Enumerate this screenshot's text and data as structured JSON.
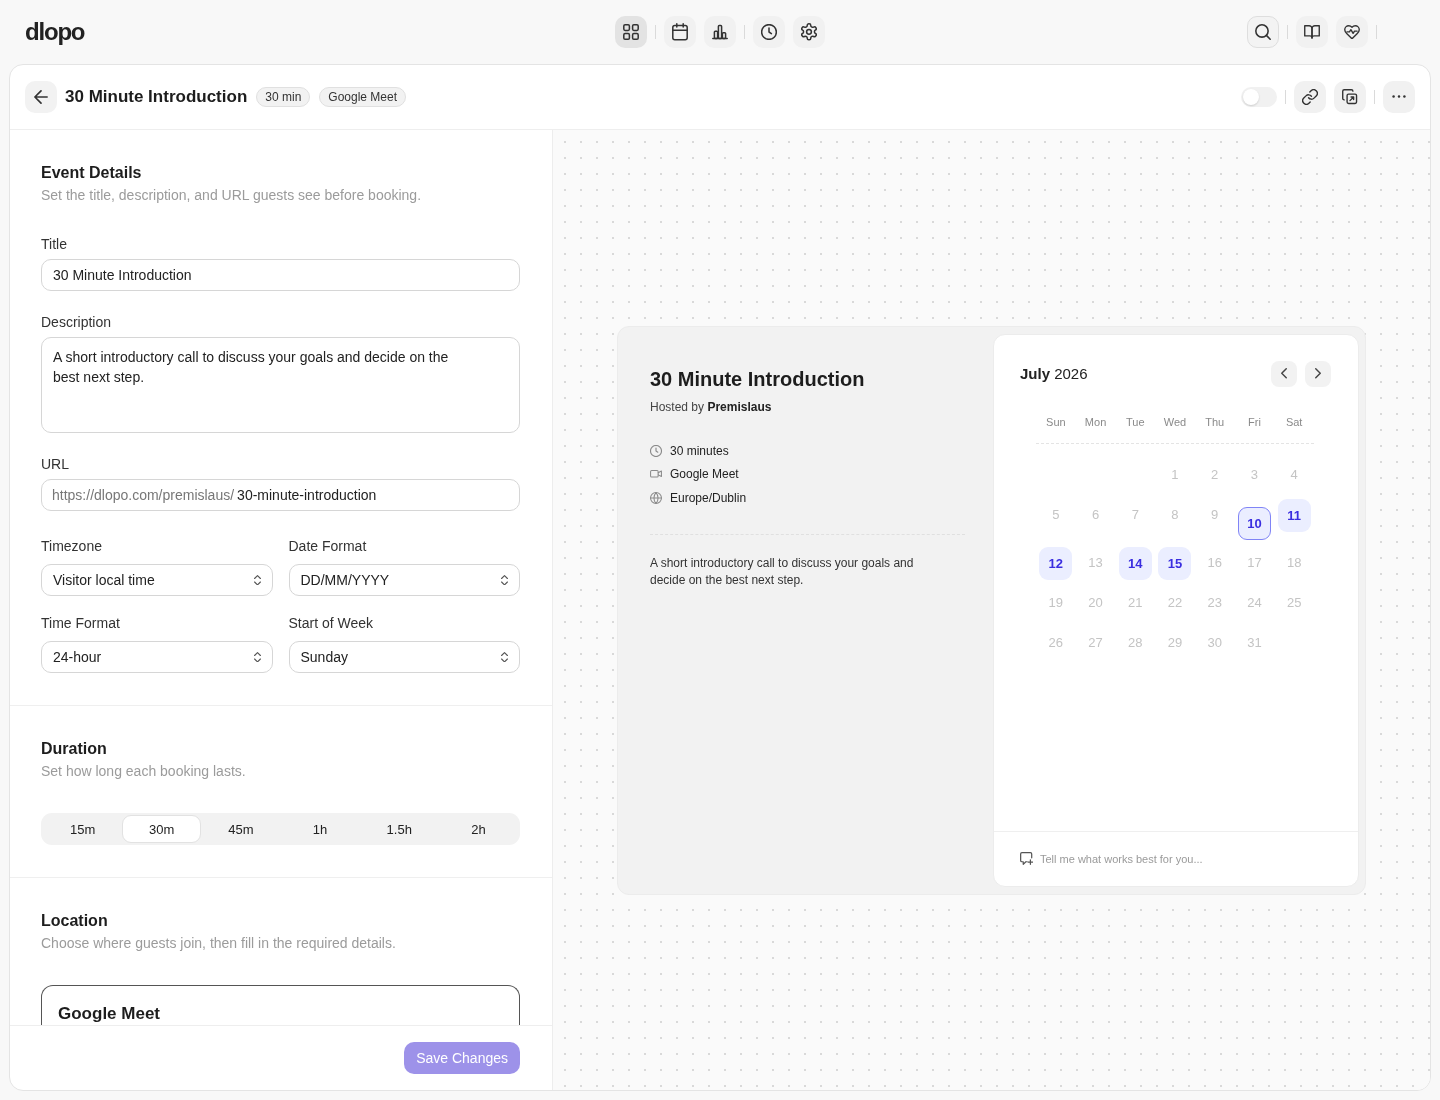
{
  "topbar": {
    "logo": "dlopo",
    "nav_groups": [
      {
        "items": [
          {
            "kind": "grid",
            "selected": true
          }
        ]
      },
      {
        "items": [
          {
            "kind": "calendar",
            "selected": false
          },
          {
            "kind": "chart",
            "selected": false
          }
        ]
      },
      {
        "items": [
          {
            "kind": "clock",
            "selected": false
          },
          {
            "kind": "gear",
            "selected": false
          }
        ]
      }
    ],
    "tool_groups": [
      {
        "items": [
          {
            "kind": "search"
          }
        ]
      },
      {
        "items": [
          {
            "kind": "book"
          },
          {
            "kind": "heart"
          }
        ]
      }
    ]
  },
  "header": {
    "title": "30 Minute Introduction",
    "badges": [
      "30 min",
      "Google Meet"
    ],
    "toggle": {
      "on": false
    },
    "action_groups": [
      {
        "items": [
          {
            "kind": "link"
          },
          {
            "kind": "duplicate"
          }
        ]
      },
      {
        "items": [
          {
            "kind": "more"
          }
        ]
      }
    ]
  },
  "details": {
    "heading": "Event Details",
    "subheading": "Set the title, description, and URL guests see before booking.",
    "title_field": {
      "label": "Title",
      "value": "30 Minute Introduction"
    },
    "description_field": {
      "label": "Description",
      "value": "A short introductory call to discuss your goals and decide on the best next step."
    },
    "url_field": {
      "label": "URL",
      "prefix": "https://dlopo.com/premislaus/",
      "value": "30-minute-introduction"
    },
    "selects": [
      {
        "label": "Timezone",
        "value": "Visitor local time"
      },
      {
        "label": "Date Format",
        "value": "DD/MM/YYYY"
      },
      {
        "label": "Time Format",
        "value": "24-hour"
      },
      {
        "label": "Start of Week",
        "value": "Sunday"
      }
    ]
  },
  "duration": {
    "heading": "Duration",
    "subheading": "Set how long each booking lasts.",
    "options": [
      {
        "label": "15m",
        "selected": false
      },
      {
        "label": "30m",
        "selected": true
      },
      {
        "label": "45m",
        "selected": false
      },
      {
        "label": "1h",
        "selected": false
      },
      {
        "label": "1.5h",
        "selected": false
      },
      {
        "label": "2h",
        "selected": false
      }
    ]
  },
  "location": {
    "heading": "Location",
    "subheading": "Choose where guests join, then fill in the required details.",
    "option_title": "Google Meet"
  },
  "footer": {
    "save_label": "Save Changes"
  },
  "preview": {
    "title": "30 Minute Introduction",
    "host": "Hosted by **Premislaus**",
    "details": [
      {
        "kind": "clock",
        "text": "30 minutes"
      },
      {
        "kind": "video",
        "text": "Google Meet"
      },
      {
        "kind": "globe",
        "text": "Europe/Dublin"
      }
    ],
    "description": "A short introductory call to discuss your goals and decide on the best next step.",
    "calendar": {
      "month": "**July** 2026",
      "weekdays": [
        "Sun",
        "Mon",
        "Tue",
        "Wed",
        "Thu",
        "Fri",
        "Sat"
      ],
      "days": [
        {
          "kind": "blank"
        },
        {
          "kind": "blank"
        },
        {
          "kind": "blank"
        },
        {
          "kind": "day",
          "label": "1",
          "available": false,
          "selected": false
        },
        {
          "kind": "day",
          "label": "2",
          "available": false,
          "selected": false
        },
        {
          "kind": "day",
          "label": "3",
          "available": false,
          "selected": false
        },
        {
          "kind": "day",
          "label": "4",
          "available": false,
          "selected": false
        },
        {
          "kind": "day",
          "label": "5",
          "available": false,
          "selected": false
        },
        {
          "kind": "day",
          "label": "6",
          "available": false,
          "selected": false
        },
        {
          "kind": "day",
          "label": "7",
          "available": false,
          "selected": false
        },
        {
          "kind": "day",
          "label": "8",
          "available": false,
          "selected": false
        },
        {
          "kind": "day",
          "label": "9",
          "available": false,
          "selected": false
        },
        {
          "kind": "day",
          "label": "10",
          "available": true,
          "selected": true
        },
        {
          "kind": "day",
          "label": "11",
          "available": true,
          "selected": false
        },
        {
          "kind": "day",
          "label": "12",
          "available": true,
          "selected": false
        },
        {
          "kind": "day",
          "label": "13",
          "available": false,
          "selected": false
        },
        {
          "kind": "day",
          "label": "14",
          "available": true,
          "selected": false
        },
        {
          "kind": "day",
          "label": "15",
          "available": true,
          "selected": false
        },
        {
          "kind": "day",
          "label": "16",
          "available": false,
          "selected": false
        },
        {
          "kind": "day",
          "label": "17",
          "available": false,
          "selected": false
        },
        {
          "kind": "day",
          "label": "18",
          "available": false,
          "selected": false
        },
        {
          "kind": "day",
          "label": "19",
          "available": false,
          "selected": false
        },
        {
          "kind": "day",
          "label": "20",
          "available": false,
          "selected": false
        },
        {
          "kind": "day",
          "label": "21",
          "available": false,
          "selected": false
        },
        {
          "kind": "day",
          "label": "22",
          "available": false,
          "selected": false
        },
        {
          "kind": "day",
          "label": "23",
          "available": false,
          "selected": false
        },
        {
          "kind": "day",
          "label": "24",
          "available": false,
          "selected": false
        },
        {
          "kind": "day",
          "label": "25",
          "available": false,
          "selected": false
        },
        {
          "kind": "day",
          "label": "26",
          "available": false,
          "selected": false
        },
        {
          "kind": "day",
          "label": "27",
          "available": false,
          "selected": false
        },
        {
          "kind": "day",
          "label": "28",
          "available": false,
          "selected": false
        },
        {
          "kind": "day",
          "label": "29",
          "available": false,
          "selected": false
        },
        {
          "kind": "day",
          "label": "30",
          "available": false,
          "selected": false
        },
        {
          "kind": "day",
          "label": "31",
          "available": false,
          "selected": false
        }
      ],
      "note_placeholder": "Tell me what works best for you..."
    }
  }
}
